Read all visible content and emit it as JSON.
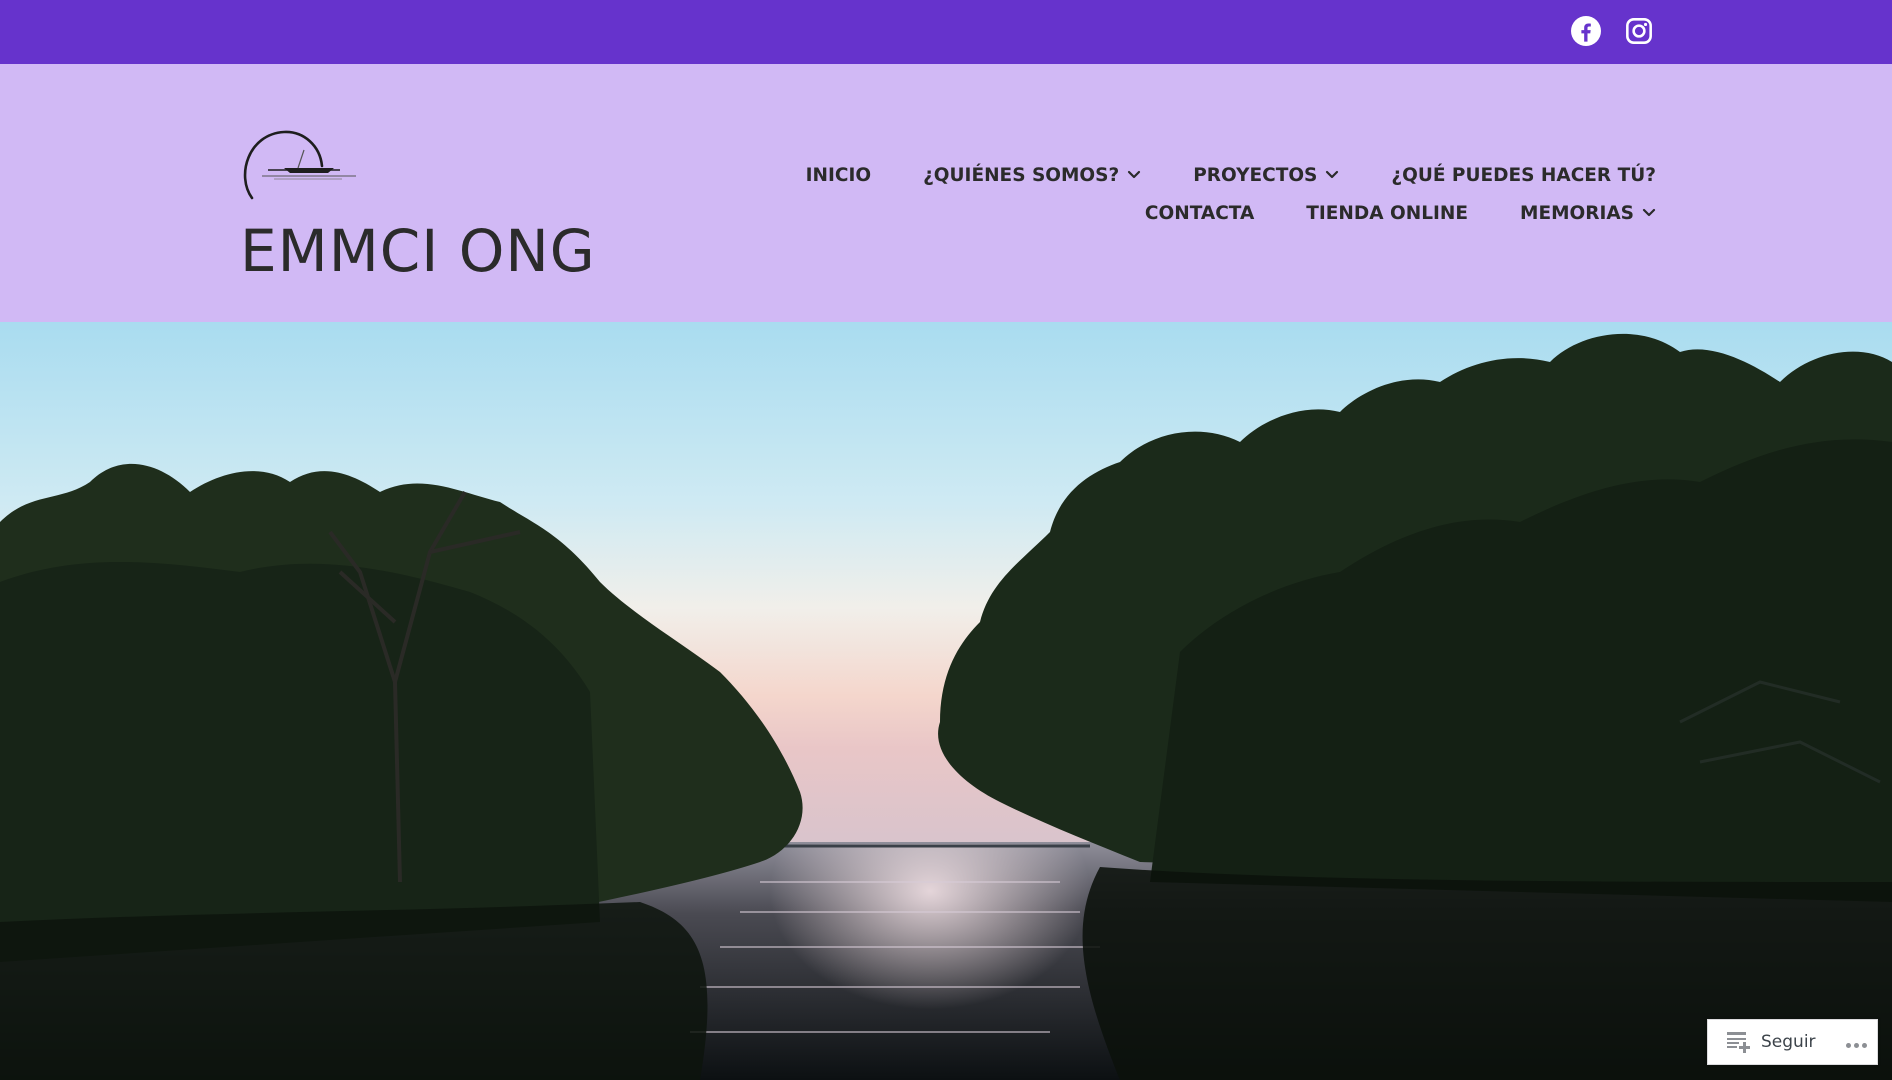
{
  "social": {
    "facebook_icon": "facebook-icon",
    "instagram_icon": "instagram-icon"
  },
  "site": {
    "title": "EMMCI ONG",
    "logo_icon": "boat-sunset-logo"
  },
  "nav": {
    "row1": [
      {
        "label": "INICIO",
        "dropdown": false
      },
      {
        "label": "¿QUIÉNES SOMOS?",
        "dropdown": true
      },
      {
        "label": "PROYECTOS",
        "dropdown": true
      },
      {
        "label": "¿QUÉ PUEDES HACER TÚ?",
        "dropdown": false
      }
    ],
    "row2": [
      {
        "label": "CONTACTA",
        "dropdown": false
      },
      {
        "label": "TIENDA ONLINE",
        "dropdown": false
      },
      {
        "label": "MEMORIAS",
        "dropdown": true
      }
    ]
  },
  "hero": {
    "image": "river-sunset-mangrove-photo"
  },
  "follow": {
    "label": "Seguir",
    "icon": "reader-follow-icon",
    "more_icon": "ellipsis-icon"
  },
  "colors": {
    "topbar": "#6633cc",
    "header": "#d1b9f5",
    "text": "#2b2b2b"
  }
}
